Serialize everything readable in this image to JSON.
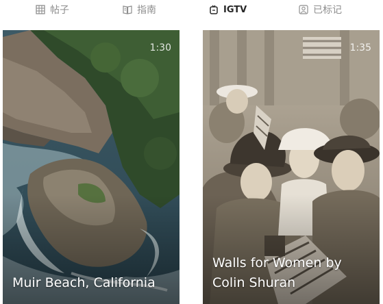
{
  "tabs": [
    {
      "label": "帖子",
      "icon": "grid-icon",
      "active": false
    },
    {
      "label": "指南",
      "icon": "guide-book-icon",
      "active": false
    },
    {
      "label": "IGTV",
      "icon": "igtv-icon",
      "active": true
    },
    {
      "label": "已标记",
      "icon": "tagged-user-icon",
      "active": false
    }
  ],
  "videos": [
    {
      "duration": "1:30",
      "title": "Muir Beach, California"
    },
    {
      "duration": "1:35",
      "title": "Walls for Women by Colin Shuran"
    }
  ]
}
